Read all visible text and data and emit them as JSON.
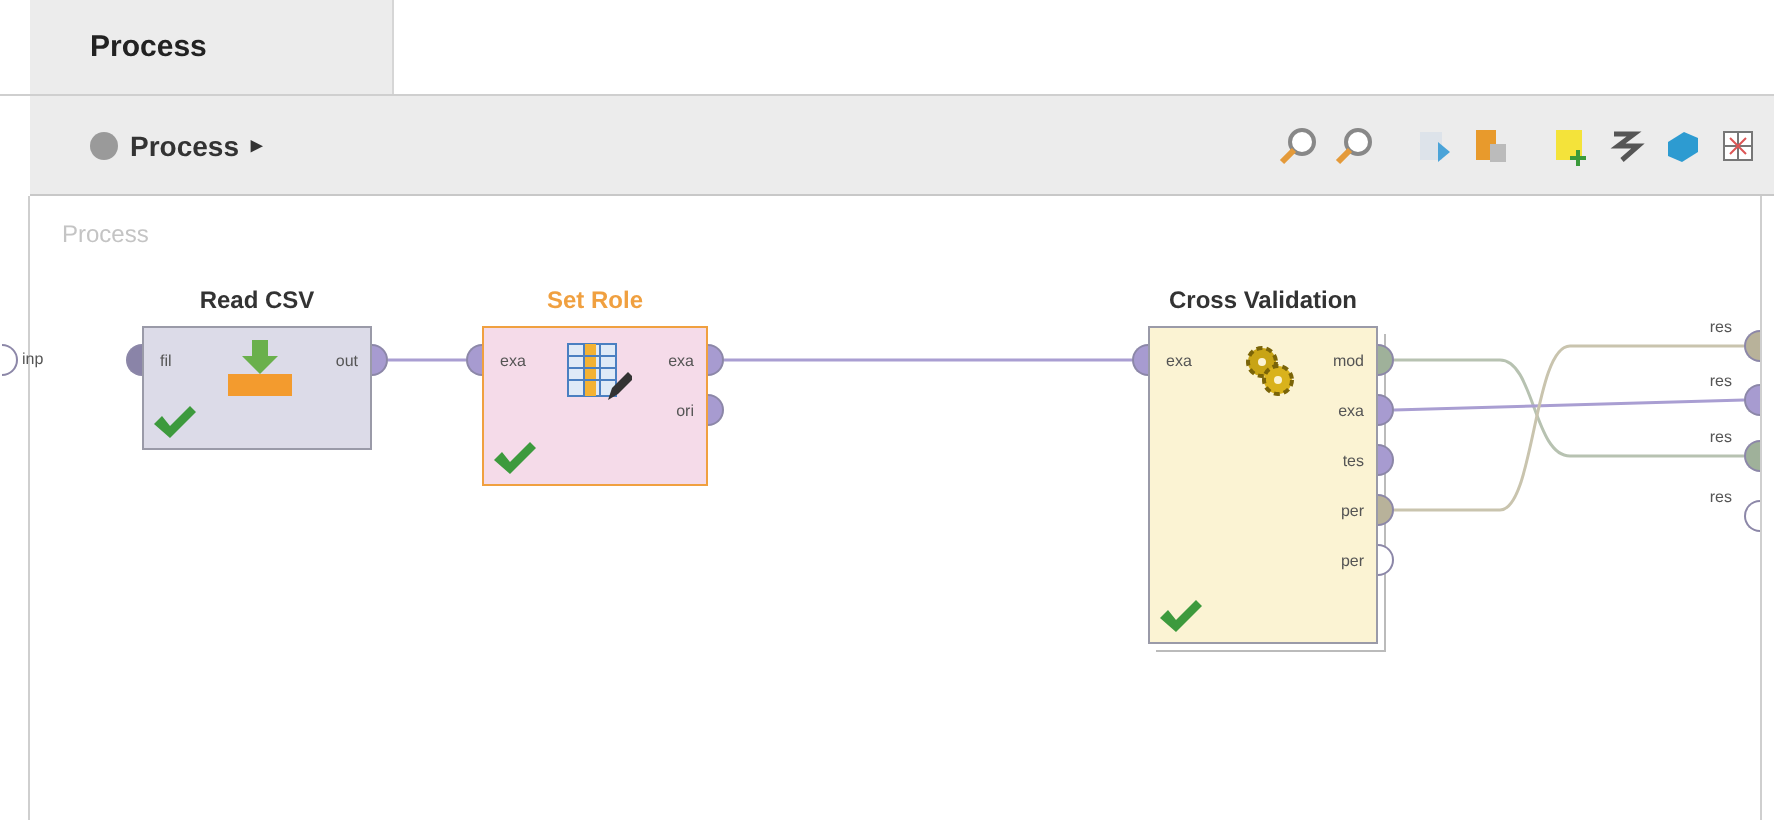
{
  "tabs": [
    {
      "label": "Process",
      "selected": true
    }
  ],
  "breadcrumb": {
    "label": "Process",
    "arrow": "▸"
  },
  "canvas": {
    "label": "Process",
    "inputs": [
      {
        "label": "inp",
        "color": "#ffffff"
      }
    ],
    "operators": [
      {
        "title": "Read CSV",
        "selected": false,
        "ok": true,
        "inputs": [
          {
            "label": "fil",
            "color": "#8a84a8"
          }
        ],
        "outputs": [
          {
            "label": "out",
            "color": "#a79bd0"
          }
        ]
      },
      {
        "title": "Set Role",
        "selected": true,
        "ok": true,
        "inputs": [
          {
            "label": "exa",
            "color": "#a79bd0"
          }
        ],
        "outputs": [
          {
            "label": "exa",
            "color": "#a79bd0"
          },
          {
            "label": "ori",
            "color": "#a79bd0"
          }
        ]
      },
      {
        "title": "Cross Validation",
        "selected": false,
        "ok": true,
        "inputs": [
          {
            "label": "exa",
            "color": "#a79bd0"
          }
        ],
        "outputs": [
          {
            "label": "mod",
            "color": "#9fb19a"
          },
          {
            "label": "exa",
            "color": "#a79bd0"
          },
          {
            "label": "tes",
            "color": "#a79bd0"
          },
          {
            "label": "per",
            "color": "#b8b29a"
          },
          {
            "label": "per",
            "color": "#ffffff"
          }
        ]
      }
    ],
    "results": [
      {
        "label": "res",
        "color": "#b8b29a"
      },
      {
        "label": "res",
        "color": "#a79bd0"
      },
      {
        "label": "res",
        "color": "#9fb19a"
      },
      {
        "label": "res",
        "color": "#ffffff"
      }
    ]
  }
}
